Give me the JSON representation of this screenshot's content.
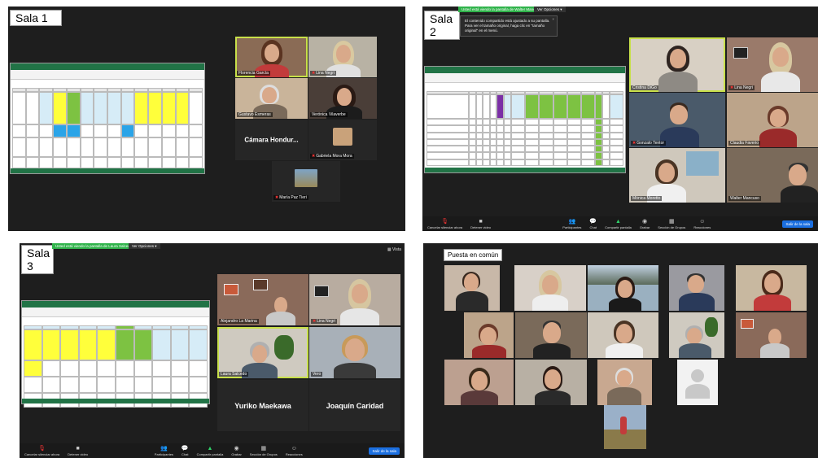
{
  "rooms": {
    "sala1": {
      "label": "Sala 1",
      "tiles": [
        {
          "name": "Florencia García",
          "muted": false
        },
        {
          "name": "Lina Negri",
          "muted": true
        },
        {
          "name": "Gustavo Esmeras",
          "muted": false
        },
        {
          "name": "Verónica Vilaverbe",
          "muted": false
        },
        {
          "name": "Cámara Hondur...",
          "muted": false
        },
        {
          "name": "Gabriela Mora Mora",
          "muted": true
        },
        {
          "name": "María Paz Tieri",
          "muted": true
        }
      ]
    },
    "sala2": {
      "label": "Sala 2",
      "banner": "Usted está viendo la pantalla de Walter Mancuso",
      "view_options": "Ver Opciones ▾",
      "tooltip": "El contenido compartido está ajustado a su pantalla. Para ver el tamaño original, haga clic en \"tamaño original\" en el menú.",
      "tiles": [
        {
          "name": "Cristina DiGo",
          "muted": false
        },
        {
          "name": "Lina Negri",
          "muted": true
        },
        {
          "name": "Gonzalo Tentor",
          "muted": true
        },
        {
          "name": "Claudia Faverio",
          "muted": false
        },
        {
          "name": "Mónica Moretto",
          "muted": false
        },
        {
          "name": "Walter Mancuso",
          "muted": false
        }
      ],
      "toolbar": {
        "left": [
          {
            "icon": "mic-off-icon",
            "label": "Cancelar silenciar ahora"
          },
          {
            "icon": "video-icon",
            "label": "Detener video"
          }
        ],
        "center": [
          {
            "icon": "participants-icon",
            "label": "Participantes",
            "count": "5"
          },
          {
            "icon": "chat-icon",
            "label": "Chat"
          },
          {
            "icon": "share-icon",
            "label": "Compartir pantalla"
          },
          {
            "icon": "record-icon",
            "label": "Grabar"
          },
          {
            "icon": "breakout-icon",
            "label": "Sección de Grupos"
          },
          {
            "icon": "reactions-icon",
            "label": "Reacciones"
          }
        ],
        "leave": "Salir de la sala"
      }
    },
    "sala3": {
      "label": "Sala 3",
      "banner": "Usted está viendo la pantalla de Laura Salcedo",
      "view_options": "Ver Opciones ▾",
      "vista": "Vista",
      "tiles": [
        {
          "name": "Alejandro La Marina",
          "muted": false
        },
        {
          "name": "Lina Negri",
          "muted": true
        },
        {
          "name": "Laura Salcedo",
          "muted": false
        },
        {
          "name": "Vero",
          "muted": false
        }
      ],
      "big_names": [
        "Yuriko Maekawa",
        "Joaquín Caridad"
      ],
      "toolbar": {
        "left": [
          {
            "icon": "mic-off-icon",
            "label": "Cancelar silenciar ahora"
          },
          {
            "icon": "video-icon",
            "label": "Detener video"
          }
        ],
        "center": [
          {
            "icon": "participants-icon",
            "label": "Participantes",
            "count": "5"
          },
          {
            "icon": "chat-icon",
            "label": "Chat"
          },
          {
            "icon": "share-icon",
            "label": "Compartir pantalla"
          },
          {
            "icon": "record-icon",
            "label": "Grabar"
          },
          {
            "icon": "breakout-icon",
            "label": "Sección de Grupos"
          },
          {
            "icon": "reactions-icon",
            "label": "Reacciones"
          }
        ],
        "leave": "Salir de la sala"
      }
    },
    "puesta": {
      "label": "Puesta en común"
    }
  },
  "colors": {
    "zoom_bg": "#1e1e1e",
    "active_speaker": "#c8e04a",
    "share_green": "#2fb34a",
    "leave_blue": "#1b6fe0",
    "excel_green": "#217346"
  }
}
